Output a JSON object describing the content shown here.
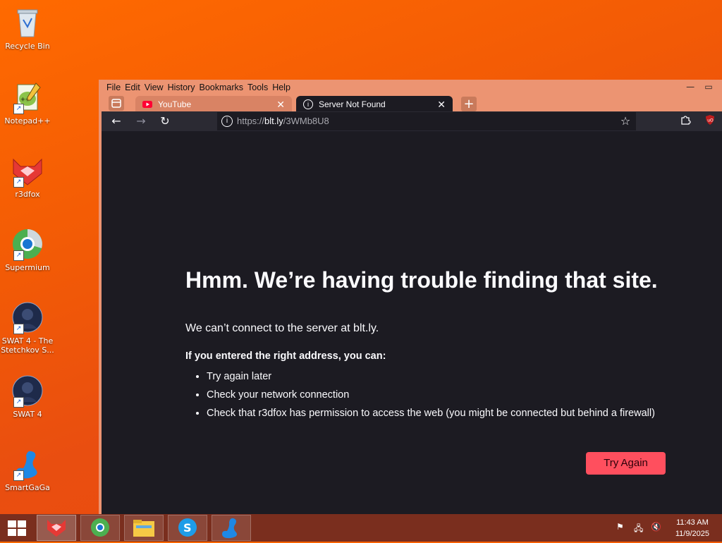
{
  "desktop": {
    "icons": [
      {
        "label": "Recycle Bin"
      },
      {
        "label": "Notepad++"
      },
      {
        "label": "r3dfox"
      },
      {
        "label": "Supermium"
      },
      {
        "label": "SWAT 4 - The Stetchkov S..."
      },
      {
        "label": "SWAT 4"
      },
      {
        "label": "SmartGaGa"
      }
    ]
  },
  "browser": {
    "menu": [
      "File",
      "Edit",
      "View",
      "History",
      "Bookmarks",
      "Tools",
      "Help"
    ],
    "tabs": [
      {
        "title": "YouTube",
        "active": false
      },
      {
        "title": "Server Not Found",
        "active": true
      }
    ],
    "url": {
      "scheme": "https://",
      "host": "blt.ly",
      "path": "/3WMb8U8"
    },
    "error": {
      "title": "Hmm. We’re having trouble finding that site.",
      "subtitle": "We can’t connect to the server at blt.ly.",
      "lead": "If you entered the right address, you can:",
      "items": [
        "Try again later",
        "Check your network connection",
        "Check that r3dfox has permission to access the web (you might be connected but behind a firewall)"
      ],
      "button": "Try Again"
    }
  },
  "taskbar": {
    "time": "11:43 AM",
    "date": "11/9/2025"
  },
  "colors": {
    "desktop": "#f25a06",
    "page_bg": "#1c1b22",
    "button": "#ff4f5e",
    "tab_strip": "#ec9472"
  }
}
